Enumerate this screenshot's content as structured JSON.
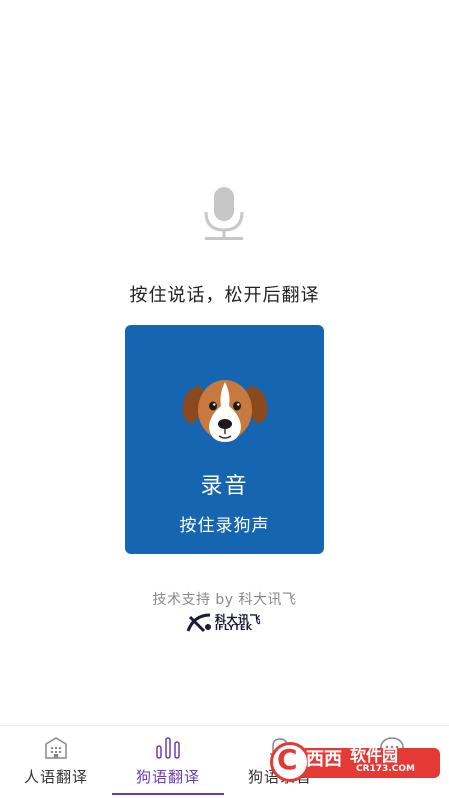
{
  "instruction": "按住说话，松开后翻译",
  "record": {
    "title": "录音",
    "hint": "按住录狗声"
  },
  "support": {
    "text": "技术支持 by 科大讯飞",
    "brand_cn": "科大讯飞",
    "brand_en": "IFLYTEK"
  },
  "tabs": [
    {
      "label": "人语翻译",
      "icon": "building-icon",
      "active": false
    },
    {
      "label": "狗语翻译",
      "icon": "sound-bars-icon",
      "active": true
    },
    {
      "label": "狗语录音",
      "icon": "bell-icon",
      "active": false
    },
    {
      "label": "",
      "icon": "chat-bubble-icon",
      "active": false
    }
  ],
  "watermark": {
    "letter": "C",
    "name": "西西",
    "soft": "软件园",
    "url": "CR173.COM"
  },
  "colors": {
    "card": "#1565b0",
    "accent": "#6a3db8",
    "watermark": "#e53935"
  }
}
